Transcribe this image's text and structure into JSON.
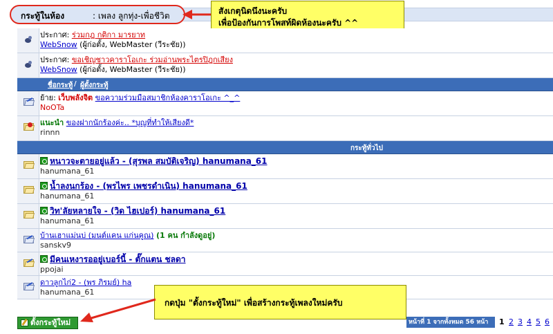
{
  "header": {
    "room_label": "กระทู้ในห้อง",
    "room_name": ": เพลง ลูกทุ่ง-เพื่อชีวิต",
    "note_lines": [
      "สังเกตุนิดนึงนะครับ",
      "เพื่อป้องกันการโพสท์ผิดห้องนะครับ ^^"
    ]
  },
  "announcements": [
    {
      "label": "ประกาศ:",
      "title": "ร่วมกฎ กติกา มารยาท",
      "author": "WebSnow",
      "roles": "(ผู้ก่อตั้ง, WebMaster (วีระชัย))"
    },
    {
      "label": "ประกาศ:",
      "title": "ขอเชิญชาวคาราโอเกะ ร่วมอ่านพระไตรปิฎกเสียง",
      "author": "WebSnow",
      "roles": "(ผู้ก่อตั้ง, WebMaster (วีระชัย))"
    }
  ],
  "columns": {
    "topic": "ชื่อกระทู้",
    "sep": "/",
    "starter": "ผู้ตั้งกระทู้"
  },
  "pinned": [
    {
      "prefix": "ย้าย:",
      "tag": "เว็บพลังจิต",
      "title": "ขอความร่วมมือสมาชิกห้องคาราโอเกะ ^_^",
      "author": "NoOTa"
    },
    {
      "prefix": "แนะนำ",
      "tag": "",
      "title": "ของฝากนักร้องค่ะ.. *บุญที่ทำให้เสียงดี*",
      "author": "rinnn"
    }
  ],
  "general_header": "กระทู้ทั่วไป",
  "topics": [
    {
      "title": "หนาวจะตายอยู่แล้ว - (สุรพล สมบัติเจริญ) hanumana_61",
      "author": "hanumana_61",
      "bold": true,
      "viewers": ""
    },
    {
      "title": "น้ำลงนกร้อง - (พรไพร เพชรดำเนิน) hanumana_61",
      "author": "hanumana_61",
      "bold": true,
      "viewers": ""
    },
    {
      "title": "วิท'ลัยหลายใจ - (วิด ไฮเปอร์) hanumana_61",
      "author": "hanumana_61",
      "bold": true,
      "viewers": ""
    },
    {
      "title": "บ้านเฮาแม่นบ่ (มนต์แคน แก่นคูณ)",
      "author": "sanskv9",
      "bold": false,
      "viewers": "(1 คน กำลังดูอยู่)"
    },
    {
      "title": "มีคนเหงารออยู่เบอร์นี้ - ตั๊กแตน ชลดา",
      "author": "ppojai",
      "bold": true,
      "viewers": ""
    },
    {
      "title": "ดาวลูกไก่2 - (พร ภิรมย์) ha",
      "author": "hanumana_61",
      "bold": false,
      "viewers": ""
    }
  ],
  "bottom_note": "กดปุ่ม \"ตั้งกระทู้ใหม่\" เพื่อสร้างกระทู้เพลงใหม่ครับ",
  "new_topic_button": "ตั้งกระทู้ใหม่",
  "pager": {
    "info": "หน้าที่ 1 จากทั้งหมด 56 หน้า",
    "current": "1",
    "pages": [
      "2",
      "3",
      "4",
      "5",
      "6"
    ]
  },
  "colors": {
    "accent_blue": "#3c6db8",
    "note_yellow": "#ffff66",
    "arrow_red": "#e0281c",
    "button_green": "#2f9a32"
  }
}
